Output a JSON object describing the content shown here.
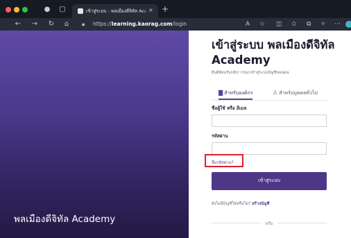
{
  "browser": {
    "tab_title": "เข้าสู่ระบบ - พลเมืองดีจิทัล Acade",
    "tab_close": "×",
    "new_tab": "+",
    "url_prefix": "https://",
    "url_host": "learning.kaorag.com",
    "url_path": "/login",
    "nav_icons": [
      "back-icon",
      "forward-icon",
      "reload-icon",
      "home-icon"
    ],
    "toolbar_icons": [
      "read-aloud-icon",
      "favorite-icon",
      "split-screen-icon",
      "favorites-bar-icon",
      "collections-icon",
      "extensions-icon",
      "more-icon"
    ],
    "colors": {
      "frame": "#151a23",
      "toolbar": "#262c38"
    }
  },
  "hero": {
    "title": "พลเมืองดีจิทัล Academy",
    "colors": {
      "top": "#5e4aa6",
      "bottom": "#231a44"
    }
  },
  "login": {
    "heading": "เข้าสู่ระบบ พลเมืองดีจิทัล Academy",
    "subtitle": "ยินดีต้อนรับกลับ! กรุณาเข้าสู่ระบบบัญชีของคุณ",
    "tabs": [
      {
        "label": "สำหรับองค์กร",
        "icon": "building-icon",
        "active": true
      },
      {
        "label": "สำหรับบุคคลทั่วไป",
        "icon": "user-icon",
        "active": false
      }
    ],
    "username_label": "ชื่อผู้ใช้ หรือ อีเมล",
    "username_value": "",
    "password_label": "รหัสผ่าน",
    "password_value": "",
    "forgot_label": "ลืมรหัสผ่าน?",
    "submit_label": "เข้าสู่ระบบ",
    "signup_prompt": "ยังไม่มีบัญชีใช่หรือไม่?",
    "signup_link": "สร้างบัญชี",
    "or_label": "หรือ",
    "colors": {
      "accent": "#4f3787",
      "highlight": "#e01b2a"
    }
  }
}
